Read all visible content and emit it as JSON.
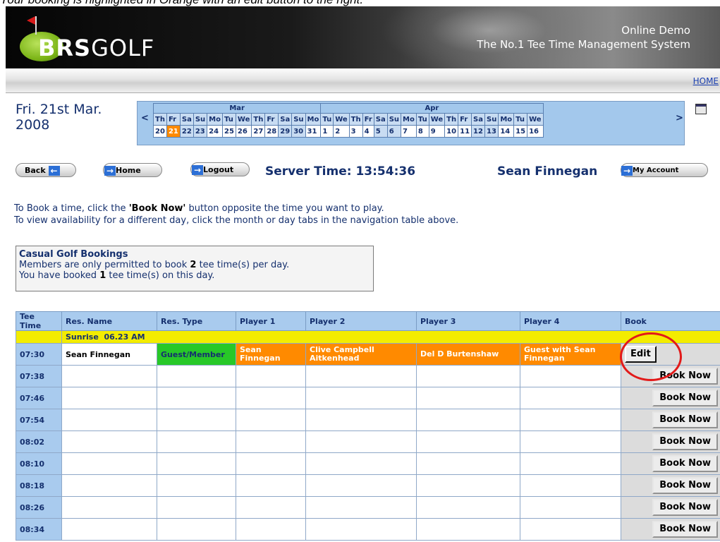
{
  "caption": "Your booking is highlighted in Orange with an edit button to the right.",
  "header": {
    "logo_part1": "BRS",
    "logo_part2": "GOLF",
    "subtitle_line1": "Online Demo",
    "subtitle_line2": "The No.1 Tee Time Management System",
    "home_link": "HOME"
  },
  "date": {
    "line1": "Fri. 21st Mar.",
    "line2": "2008"
  },
  "calendar": {
    "prev": "<",
    "next": ">",
    "months": [
      {
        "label": "Mar"
      },
      {
        "label": "Apr"
      }
    ],
    "days": [
      {
        "d": "Th",
        "n": "20"
      },
      {
        "d": "Fr",
        "n": "21"
      },
      {
        "d": "Sa",
        "n": "22"
      },
      {
        "d": "Su",
        "n": "23"
      },
      {
        "d": "Mo",
        "n": "24"
      },
      {
        "d": "Tu",
        "n": "25"
      },
      {
        "d": "We",
        "n": "26"
      },
      {
        "d": "Th",
        "n": "27"
      },
      {
        "d": "Fr",
        "n": "28"
      },
      {
        "d": "Sa",
        "n": "29"
      },
      {
        "d": "Su",
        "n": "30"
      },
      {
        "d": "Mo",
        "n": "31"
      },
      {
        "d": "Tu",
        "n": "1"
      },
      {
        "d": "We",
        "n": "2"
      },
      {
        "d": "Th",
        "n": "3"
      },
      {
        "d": "Fr",
        "n": "4"
      },
      {
        "d": "Sa",
        "n": "5"
      },
      {
        "d": "Su",
        "n": "6"
      },
      {
        "d": "Mo",
        "n": "7"
      },
      {
        "d": "Tu",
        "n": "8"
      },
      {
        "d": "We",
        "n": "9"
      },
      {
        "d": "Th",
        "n": "10"
      },
      {
        "d": "Fr",
        "n": "11"
      },
      {
        "d": "Sa",
        "n": "12"
      },
      {
        "d": "Su",
        "n": "13"
      },
      {
        "d": "Mo",
        "n": "14"
      },
      {
        "d": "Tu",
        "n": "15"
      },
      {
        "d": "We",
        "n": "16"
      }
    ],
    "selected_day": "21",
    "weekend_days": [
      "22",
      "23",
      "29",
      "30",
      "5",
      "6",
      "12",
      "13"
    ]
  },
  "nav": {
    "back": "Back",
    "home": "Home",
    "logout": "Logout",
    "server_time": "Server Time: 13:54:36",
    "user": "Sean Finnegan",
    "my_account": "My Account"
  },
  "info": {
    "line1_pre": "To Book a time, click the ",
    "line1_bold": "'Book Now'",
    "line1_post": " button opposite the time you want to play.",
    "line2": "To view availability for a different day, click the month or day tabs in the navigation table above."
  },
  "notice": {
    "title": "Casual Golf Bookings",
    "line1_pre": "Members are only permitted to book ",
    "line1_num": "2",
    "line1_post": " tee time(s) per day.",
    "line2_pre": "You have booked ",
    "line2_num": "1",
    "line2_post": " tee time(s) on this day."
  },
  "table": {
    "headers": [
      "Tee Time",
      "Res. Name",
      "Res. Type",
      "Player 1",
      "Player 2",
      "Player 3",
      "Player 4",
      "Book"
    ],
    "sunrise": "Sunrise  06.23 AM",
    "booked": {
      "time": "07:30",
      "res_name": "Sean Finnegan",
      "res_type": "Guest/Member",
      "player1": "Sean Finnegan",
      "player2": "Clive Campbell Aitkenhead",
      "player3": "Del D Burtenshaw",
      "player4": "Guest with Sean Finnegan",
      "button": "Edit"
    },
    "open_times": [
      "07:38",
      "07:46",
      "07:54",
      "08:02",
      "08:10",
      "08:18",
      "08:26",
      "08:34"
    ],
    "book_label": "Book Now"
  },
  "colors": {
    "accent": "#ff8a00",
    "member_green": "#28c828",
    "header_blue": "#a9cbee",
    "sunrise_yellow": "#f3ec00",
    "highlight_circle": "#e21a1a"
  }
}
